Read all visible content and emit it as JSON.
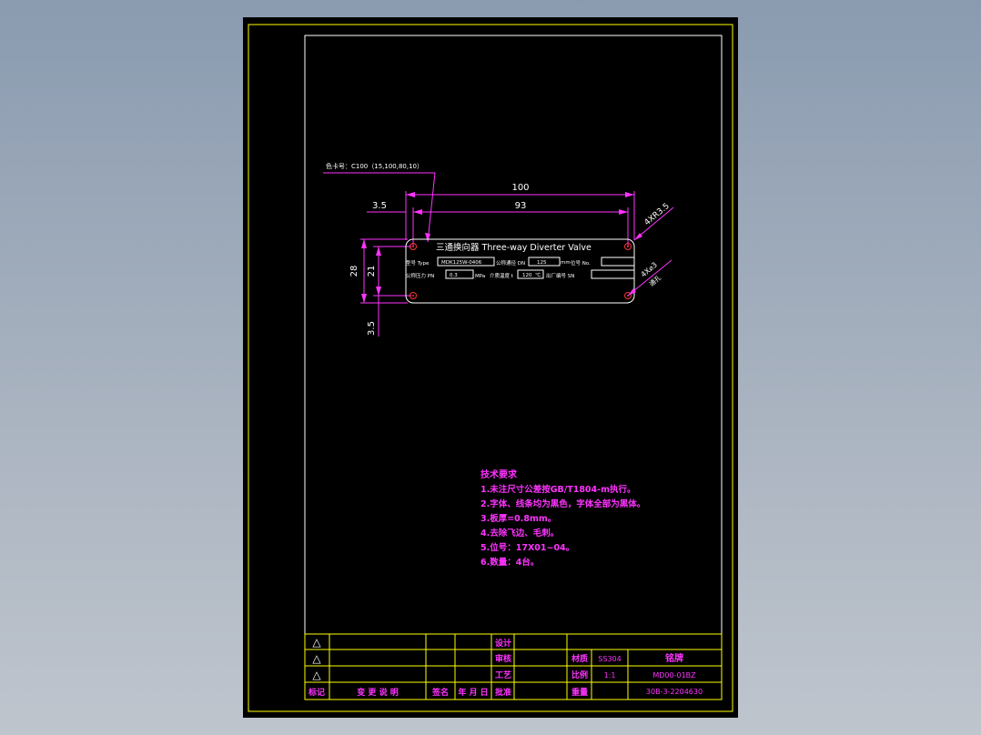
{
  "colors": {
    "background": "#000000",
    "frame": "#ffff00",
    "border": "#ffffff",
    "dimension": "#ff33ff",
    "outline": "#ffffff",
    "holes": "#ff3333"
  },
  "drawing": {
    "color_note": "色卡号：C100（15,100,80,10）",
    "dims": {
      "overall_width": "100",
      "hole_spacing": "93",
      "left_offset": "3.5",
      "overall_height": "28",
      "hole_vertical": "21",
      "bottom_offset": "3.5",
      "corner_radius": "4XR3.5",
      "hole_size": "4X⌀3",
      "hole_type": "通孔"
    },
    "plate": {
      "title": "三通换向器 Three-way Diverter Valve",
      "row1_label1": "型号 Type",
      "row1_value1": "MDK125W-0406",
      "row1_label2": "公称通径 DN",
      "row1_value2": "125",
      "row1_unit2": "mm",
      "row1_label3": "位号 No.",
      "row2_label1": "公称压力 PN",
      "row2_value1": "0.3",
      "row2_unit1": "MPa",
      "row2_label2": "介质温度 t",
      "row2_value2": "120",
      "row2_unit2": "℃",
      "row2_label3": "出厂编号 SN"
    }
  },
  "tech_requirements": {
    "title": "技术要求",
    "items": [
      "1.未注尺寸公差按GB/T1804-m执行。",
      "2.字体、线条均为黑色，字体全部为黑体。",
      "3.板厚=0.8mm。",
      "4.去除飞边、毛刺。",
      "5.位号：17X01~04。",
      "6.数量：4台。"
    ]
  },
  "title_block": {
    "revision_symbol": "△",
    "col_marker": "标记",
    "col_change": "变 更 说 明",
    "col_sign": "签名",
    "col_date": "年 月 日",
    "row_design": "设计",
    "row_review": "审核",
    "row_process": "工艺",
    "row_approve": "批准",
    "material_label": "材质",
    "material_value": "SS304",
    "scale_label": "比例",
    "scale_value": "1:1",
    "weight_label": "重量",
    "part_name": "铭牌",
    "drawing_number": "MD00-01BZ",
    "doc_number": "30B-3-2204630"
  }
}
